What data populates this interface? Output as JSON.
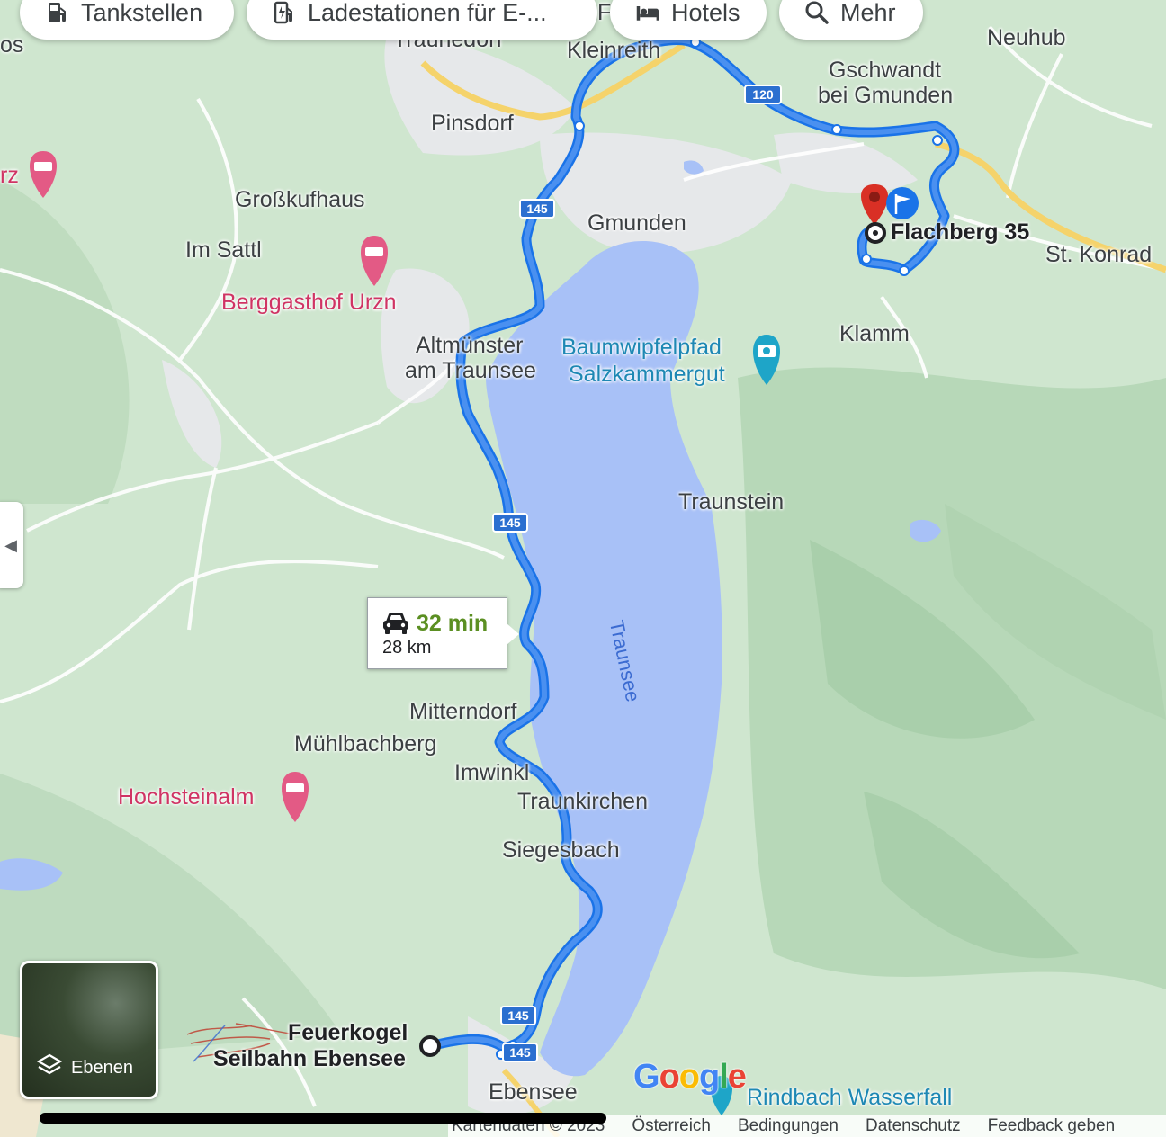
{
  "chips": [
    {
      "label": "Tankstellen",
      "icon": "fuel-icon"
    },
    {
      "label": "Ladestationen für E-...",
      "icon": "ev-charger-icon"
    },
    {
      "label": "Hotels",
      "icon": "hotel-bed-icon"
    },
    {
      "label": "Mehr",
      "icon": "search-icon"
    }
  ],
  "places": {
    "kleinreith": "Kleinreith",
    "neuhub": "Neuhub",
    "gschwandt_1": "Gschwandt",
    "gschwandt_2": "bei Gmunden",
    "pinsdorf": "Pinsdorf",
    "grosskufhaus": "Großkufhaus",
    "im_sattl": "Im Sattl",
    "berggasthof": "Berggasthof Urzn",
    "gmunden": "Gmunden",
    "st_konrad": "St. Konrad",
    "klamm": "Klamm",
    "altmuenster_1": "Altmünster",
    "altmuenster_2": "am Traunsee",
    "baumwipfel_1": "Baumwipfelpfad",
    "baumwipfel_2": "Salzkammergut",
    "traunstein": "Traunstein",
    "traunsee": "Traunsee",
    "mitterndorf": "Mitterndorf",
    "muehlbachberg": "Mühlbachberg",
    "imwinkl": "Imwinkl",
    "hochsteinalm": "Hochsteinalm",
    "traunkirchen": "Traunkirchen",
    "siegesbach": "Siegesbach",
    "feuerkogel_1": "Feuerkogel",
    "feuerkogel_2": "Seilbahn Ebensee",
    "ebensee": "Ebensee",
    "rindbach": "Rindbach Wasserfall",
    "partial_left_top": "os",
    "partial_left_hotel": "rz",
    "partial_top_center": "Traunedorf",
    "partial_f": "F"
  },
  "destination": "Flachberg 35",
  "route": {
    "time": "32 min",
    "distance": "28 km",
    "color": "#1a73e8",
    "fill": "#4a90f0"
  },
  "road_shields": [
    "145",
    "145",
    "145",
    "145",
    "120"
  ],
  "layers_label": "Ebenen",
  "google": [
    "G",
    "o",
    "o",
    "g",
    "l",
    "e"
  ],
  "footer": [
    "Kartendaten © 2023",
    "Österreich",
    "Bedingungen",
    "Datenschutz",
    "Feedback geben"
  ],
  "colors": {
    "land": "#cfe6cf",
    "lake": "#a8c1f7",
    "town": "#e9ecef",
    "pin": "#d93025",
    "poi_pink": "#d03464",
    "poi_blue": "#1e88b4"
  }
}
